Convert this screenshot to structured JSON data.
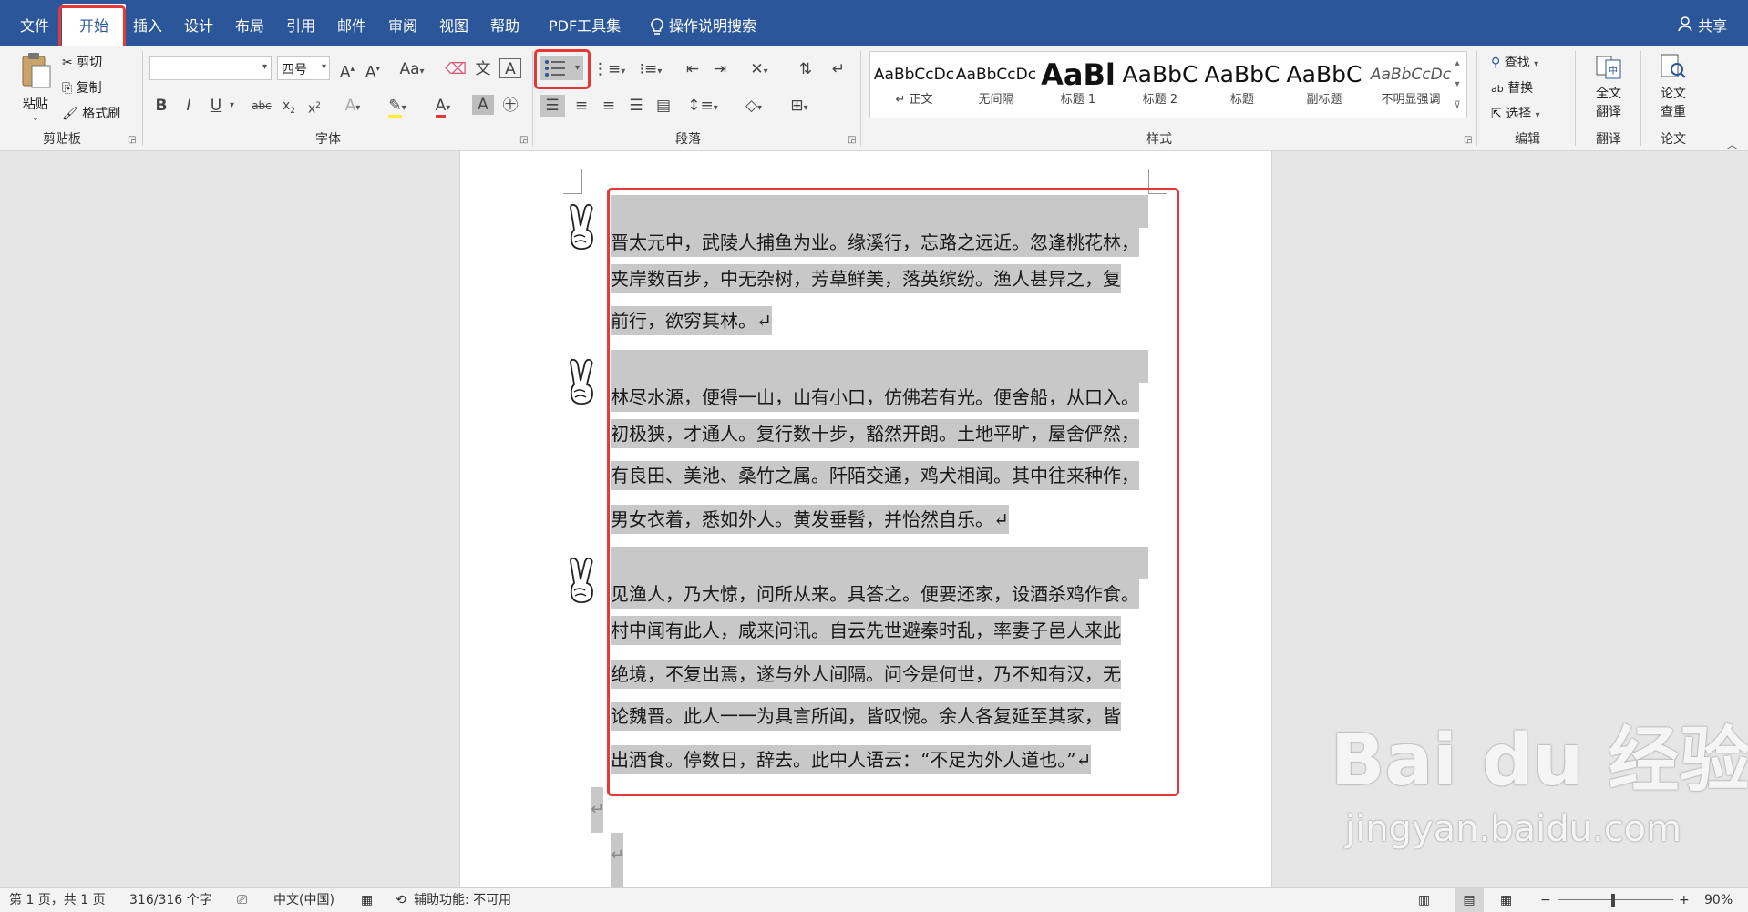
{
  "menubar": {
    "tabs": [
      {
        "label": "文件"
      },
      {
        "label": "开始"
      },
      {
        "label": "插入"
      },
      {
        "label": "设计"
      },
      {
        "label": "布局"
      },
      {
        "label": "引用"
      },
      {
        "label": "邮件"
      },
      {
        "label": "审阅"
      },
      {
        "label": "视图"
      },
      {
        "label": "帮助"
      },
      {
        "label": "PDF工具集"
      }
    ],
    "tell_me": "操作说明搜索",
    "share": "共享"
  },
  "ribbon": {
    "clipboard": {
      "paste": "粘贴",
      "cut": "剪切",
      "copy": "复制",
      "format_painter": "格式刷",
      "label": "剪贴板"
    },
    "font": {
      "font_name": "",
      "font_size": "四号",
      "label": "字体"
    },
    "paragraph": {
      "label": "段落"
    },
    "styles": {
      "label": "样式",
      "items": [
        {
          "sample": "AaBbCcDc",
          "name": "↵ 正文"
        },
        {
          "sample": "AaBbCcDc",
          "name": "无间隔"
        },
        {
          "sample": "AaBl",
          "name": "标题 1"
        },
        {
          "sample": "AaBbC",
          "name": "标题 2"
        },
        {
          "sample": "AaBbC",
          "name": "标题"
        },
        {
          "sample": "AaBbC",
          "name": "副标题"
        },
        {
          "sample": "AaBbCcDc",
          "name": "不明显强调"
        }
      ]
    },
    "editing": {
      "find": "查找",
      "replace": "替换",
      "select": "选择",
      "label": "编辑"
    },
    "translate": {
      "full_translate_1": "全文",
      "full_translate_2": "翻译",
      "label": "翻译"
    },
    "thesis": {
      "check_1": "论文",
      "check_2": "查重",
      "label": "论文"
    }
  },
  "document": {
    "paragraphs": [
      {
        "lines": [
          "晋太元中，武陵人捕鱼为业。缘溪行，忘路之远近。忽逢桃花林，",
          "夹岸数百步，中无杂树，芳草鲜美，落英缤纷。渔人甚异之，复",
          "前行，欲穷其林。↵"
        ]
      },
      {
        "lines": [
          "林尽水源，便得一山，山有小口，仿佛若有光。便舍船，从口入。",
          "初极狭，才通人。复行数十步，豁然开朗。土地平旷，屋舍俨然，",
          "有良田、美池、桑竹之属。阡陌交通，鸡犬相闻。其中往来种作，",
          "男女衣着，悉如外人。黄发垂髫，并怡然自乐。↵"
        ]
      },
      {
        "lines": [
          "见渔人，乃大惊，问所从来。具答之。便要还家，设酒杀鸡作食。",
          "村中闻有此人，咸来问讯。自云先世避秦时乱，率妻子邑人来此",
          "绝境，不复出焉，遂与外人间隔。问今是何世，乃不知有汉，无",
          "论魏晋。此人一一为具言所闻，皆叹惋。余人各复延至其家，皆",
          "出酒食。停数日，辞去。此中人语云：“不足为外人道也。”↵"
        ]
      }
    ],
    "empty_mark_1": "↵",
    "empty_mark_2": "↵"
  },
  "statusbar": {
    "page": "第 1 页，共 1 页",
    "words": "316/316 个字",
    "language": "中文(中国)",
    "accessibility": "辅助功能: 不可用",
    "zoom": "90%"
  },
  "watermark": {
    "line1": "Bai du 经验",
    "line2": "jingyan.baidu.com"
  },
  "colors": {
    "brand": "#2b579a",
    "highlight_box": "#e53935",
    "selection": "#c8c8c8"
  }
}
